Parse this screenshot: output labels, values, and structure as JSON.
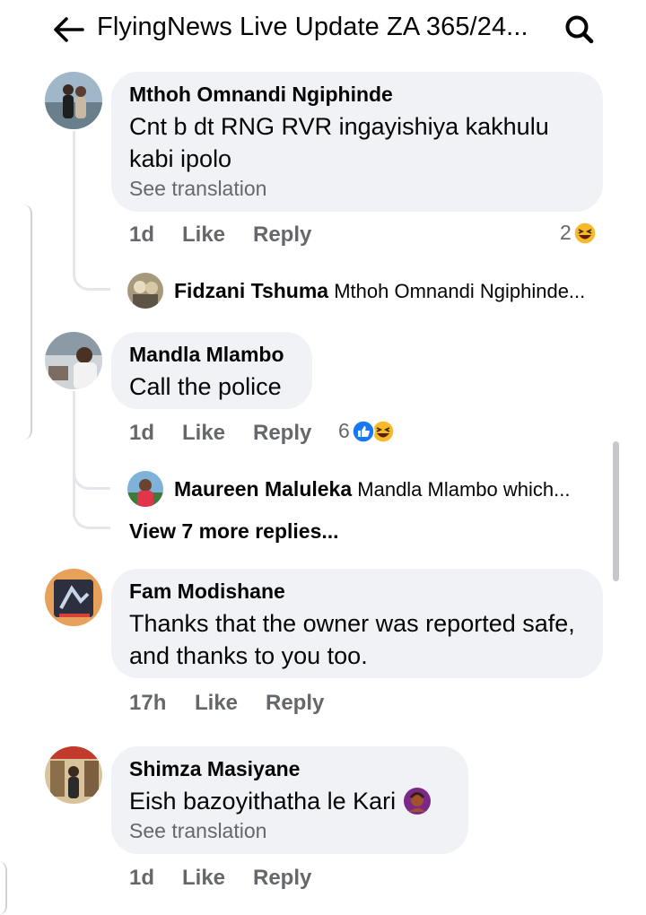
{
  "header": {
    "title": "FlyingNews Live Update ZA 365/24..."
  },
  "comments": [
    {
      "author": "Mthoh Omnandi Ngiphinde",
      "text": "Cnt b dt RNG RVR ingayishiya kakhulu kabi ipolo",
      "translation": "See translation",
      "time": "1d",
      "like": "Like",
      "reply": "Reply",
      "reaction_count": "2",
      "reply_preview": {
        "author": "Fidzani Tshuma",
        "text": "Mthoh Omnandi Ngiphinde..."
      }
    },
    {
      "author": "Mandla Mlambo",
      "text": "Call the police",
      "time": "1d",
      "like": "Like",
      "reply": "Reply",
      "reaction_count": "6",
      "reply_preview": {
        "author": "Maureen Maluleka",
        "text": "Mandla Mlambo which..."
      },
      "view_more": "View 7 more replies..."
    },
    {
      "author": "Fam Modishane",
      "text": "Thanks that the owner was reported safe, and thanks to you too.",
      "time": "17h",
      "like": "Like",
      "reply": "Reply"
    },
    {
      "author": "Shimza Masiyane",
      "text": "Eish bazoyithatha le Kari",
      "translation": "See translation",
      "time": "1d",
      "like": "Like",
      "reply": "Reply"
    }
  ],
  "colors": {
    "bubble": "#f0f2f5",
    "secondary_text": "#65676b",
    "like_blue": "#1877f2",
    "haha_yellow": "#f7b928"
  }
}
